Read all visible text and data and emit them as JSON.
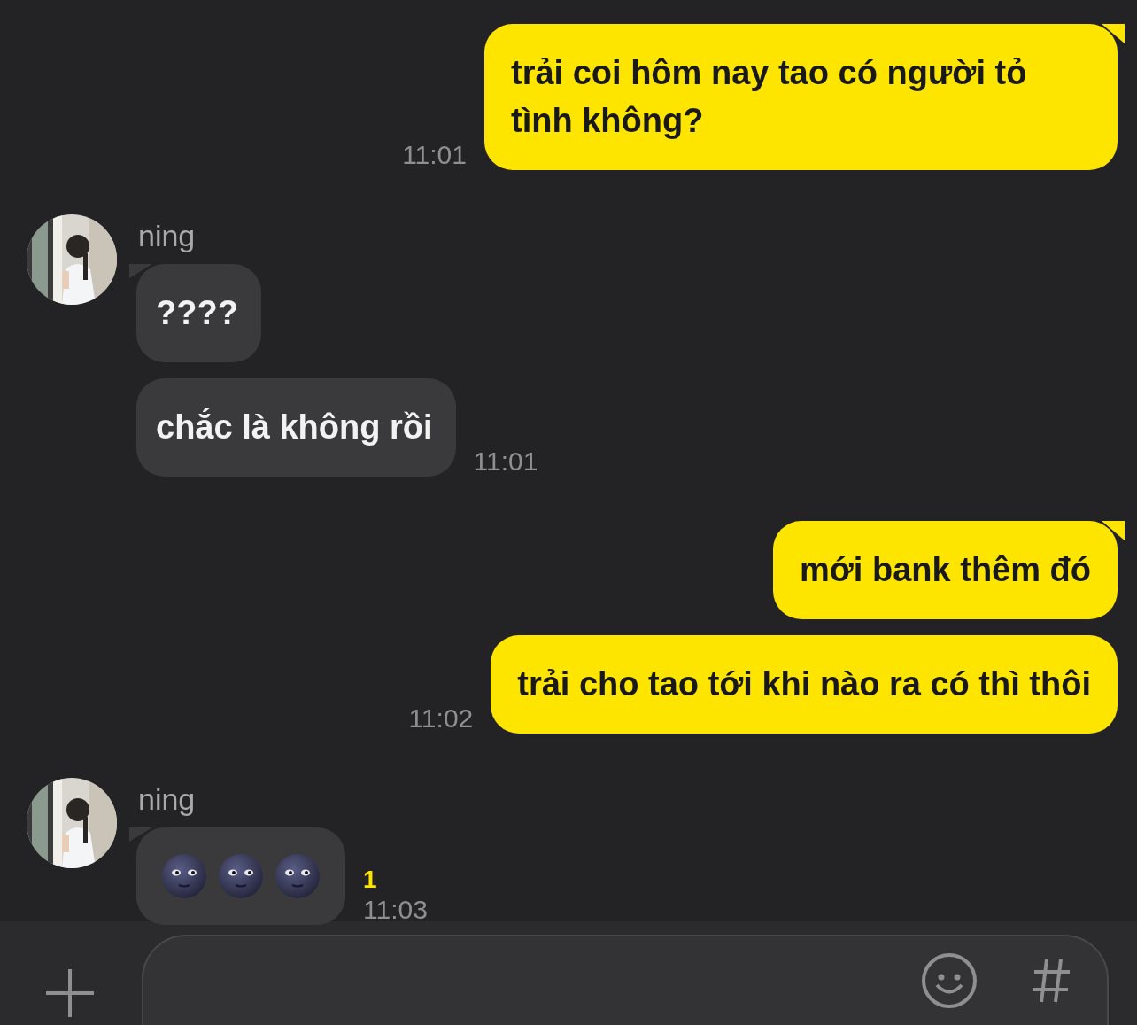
{
  "messages": [
    {
      "kind": "sent",
      "first": true,
      "text": "trải coi hôm nay tao có người tỏ tình không?",
      "time": "11:01"
    },
    {
      "kind": "received",
      "first": true,
      "name": "ning",
      "text": "????"
    },
    {
      "kind": "received",
      "first": false,
      "text": "chắc là không rồi",
      "time": "11:01"
    },
    {
      "kind": "sent",
      "first": true,
      "text": "mới bank thêm đó"
    },
    {
      "kind": "sent",
      "first": false,
      "text": "trải cho tao tới khi nào ra có thì thôi",
      "time": "11:02"
    },
    {
      "kind": "received",
      "first": true,
      "name": "ning",
      "emoji": [
        {
          "kind": "moon"
        },
        {
          "kind": "moon"
        },
        {
          "kind": "moon"
        }
      ],
      "unread": "1",
      "time": "11:03"
    }
  ],
  "composer": {
    "buttons": [
      {
        "kind": "plus"
      },
      {
        "kind": "emoji"
      },
      {
        "kind": "hashtag"
      }
    ]
  }
}
